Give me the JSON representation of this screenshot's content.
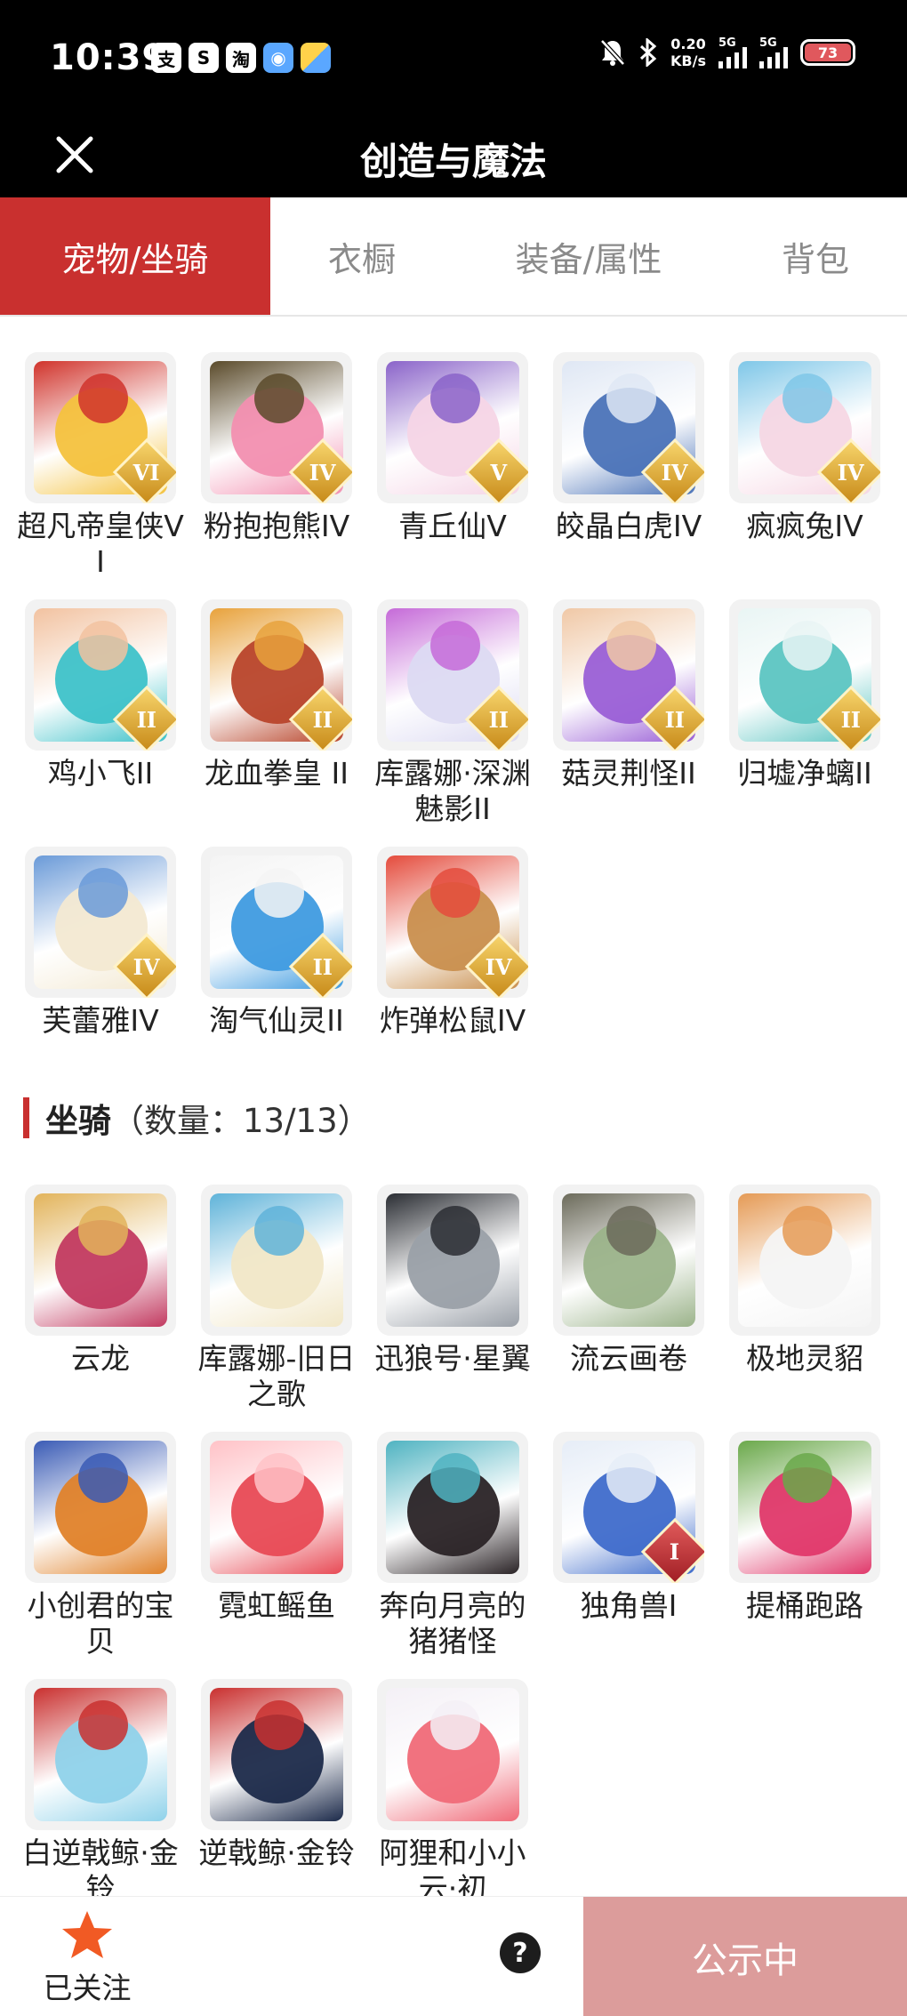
{
  "status_bar": {
    "time": "10:39",
    "notifications": [
      {
        "icon": "alipay-icon",
        "glyph": "支"
      },
      {
        "icon": "game-icon",
        "glyph": "S"
      },
      {
        "icon": "taobao-icon",
        "glyph": "淘"
      },
      {
        "icon": "camera-app-icon",
        "glyph": "◉"
      },
      {
        "icon": "file-app-icon",
        "glyph": ""
      }
    ],
    "mute_icon": "bell-off-icon",
    "bluetooth_icon": "bluetooth-icon",
    "net_speed_value": "0.20",
    "net_speed_unit": "KB/s",
    "signal1_label": "5G",
    "signal2_label": "5G",
    "battery": "73",
    "battery_color": "#e0585d"
  },
  "nav": {
    "close_icon": "close-icon",
    "title": "创造与魔法"
  },
  "tabs": [
    {
      "label": "宠物/坐骑",
      "active": true
    },
    {
      "label": "衣橱",
      "active": false
    },
    {
      "label": "装备/属性",
      "active": false
    },
    {
      "label": "背包",
      "active": false
    }
  ],
  "pets": [
    {
      "name": "超凡帝皇侠VI",
      "rank": "VI",
      "c1": "#f4c23e",
      "c2": "#d0332b"
    },
    {
      "name": "粉抱抱熊IV",
      "rank": "IV",
      "c1": "#f28fb0",
      "c2": "#5a4a2a"
    },
    {
      "name": "青丘仙V",
      "rank": "V",
      "c1": "#f5d5e6",
      "c2": "#8a63c9"
    },
    {
      "name": "皎晶白虎IV",
      "rank": "IV",
      "c1": "#4b73b8",
      "c2": "#dfe7f4"
    },
    {
      "name": "疯疯兔IV",
      "rank": "IV",
      "c1": "#f6d7e4",
      "c2": "#7fc7e8"
    },
    {
      "name": "鸡小飞II",
      "rank": "II",
      "c1": "#3ec2c9",
      "c2": "#f2c2a0"
    },
    {
      "name": "龙血拳皇 II",
      "rank": "II",
      "c1": "#b8452b",
      "c2": "#e8a23c"
    },
    {
      "name": "库露娜·深渊魅影II",
      "rank": "II",
      "c1": "#dcdaf2",
      "c2": "#c56ad8"
    },
    {
      "name": "菇灵荆怪II",
      "rank": "II",
      "c1": "#9a5fd6",
      "c2": "#f0c8a6"
    },
    {
      "name": "归墟净螭II",
      "rank": "II",
      "c1": "#5cc5c2",
      "c2": "#e9f5f4"
    },
    {
      "name": "芙蕾雅IV",
      "rank": "IV",
      "c1": "#f3e9d2",
      "c2": "#6a9ad8"
    },
    {
      "name": "淘气仙灵II",
      "rank": "II",
      "c1": "#3f9be0",
      "c2": "#f4f4f4"
    },
    {
      "name": "炸弹松鼠IV",
      "rank": "IV",
      "c1": "#c98f4e",
      "c2": "#e44b3c"
    }
  ],
  "mounts_section": {
    "title": "坐骑",
    "count_text": "（数量：13/13）"
  },
  "mounts": [
    {
      "name": "云龙",
      "rank": "",
      "c1": "#c23a60",
      "c2": "#e2b35a"
    },
    {
      "name": "库露娜-旧日之歌",
      "rank": "",
      "c1": "#f1e7c7",
      "c2": "#5fb3d9"
    },
    {
      "name": "迅狼号·星翼",
      "rank": "",
      "c1": "#9aa0a8",
      "c2": "#2a2d33"
    },
    {
      "name": "流云画卷",
      "rank": "",
      "c1": "#9bb38a",
      "c2": "#6b6a5a"
    },
    {
      "name": "极地灵貂",
      "rank": "",
      "c1": "#f4f4f4",
      "c2": "#e59a55"
    },
    {
      "name": "小创君的宝贝",
      "rank": "",
      "c1": "#e0822a",
      "c2": "#3a5bb5"
    },
    {
      "name": "霓虹鳐鱼",
      "rank": "",
      "c1": "#e84a55",
      "c2": "#ffc2c7"
    },
    {
      "name": "奔向月亮的猪猪怪",
      "rank": "",
      "c1": "#2a2326",
      "c2": "#4fb3c1"
    },
    {
      "name": "独角兽I",
      "rank": "I",
      "c1": "#3f6ccb",
      "c2": "#e6edf7"
    },
    {
      "name": "提桶跑路",
      "rank": "",
      "c1": "#e0386a",
      "c2": "#6aa84a"
    },
    {
      "name": "白逆戟鲸·金铃",
      "rank": "",
      "c1": "#8fd2ea",
      "c2": "#c9302f"
    },
    {
      "name": "逆戟鲸·金铃",
      "rank": "",
      "c1": "#1c2a4a",
      "c2": "#c9302f"
    },
    {
      "name": "阿狸和小小云·初",
      "rank": "",
      "c1": "#f06a78",
      "c2": "#f4f0f6"
    }
  ],
  "bottom": {
    "follow_icon": "star-icon",
    "follow_label": "已关注",
    "help_icon": "help-icon",
    "help_glyph": "?",
    "status_label": "公示中"
  }
}
